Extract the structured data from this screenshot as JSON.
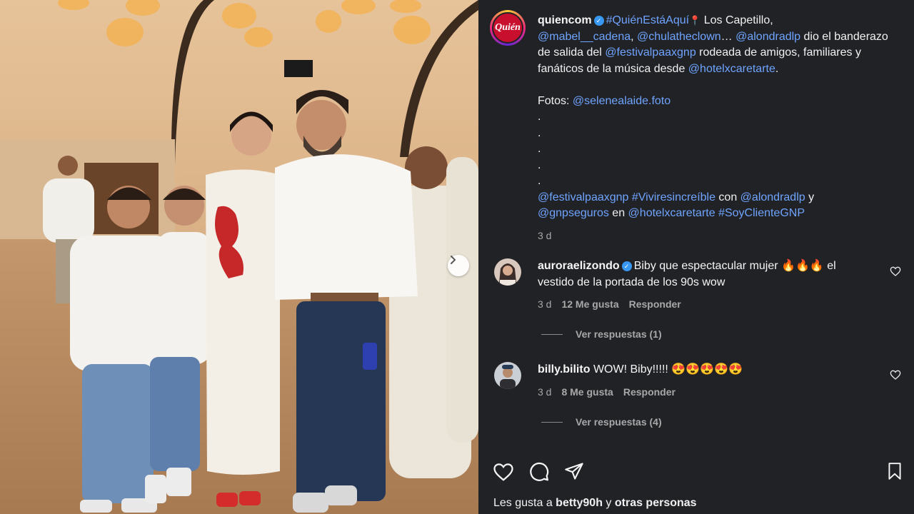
{
  "post": {
    "account": "quiencom",
    "avatar_text": "Quién",
    "caption": {
      "hashtag_here": "#QuiénEstáAquí",
      "t1": " Los Capetillo,",
      "m_mabel": "@mabel__cadena",
      "comma": ", ",
      "m_chula": "@chulatheclown",
      "ellipsis": "… ",
      "m_alondra": "@alondradlp",
      "t2": " dio el banderazo de salida del ",
      "m_festival": "@festivalpaaxgnp",
      "t3": " rodeada de amigos, familiares y fanáticos de la música desde ",
      "m_hotel": "@hotelxcaretarte",
      "t4": ".",
      "fotos_label": "Fotos: ",
      "m_selene": "@selenealaide.foto",
      "dot": ".",
      "m_festival2": "@festivalpaaxgnp",
      "sp": " ",
      "h_vivir": "#Viviresincreíble",
      "con": " con ",
      "m_alondra2": "@alondradlp",
      "y": " y",
      "m_gnp": "@gnpseguros",
      "en": " en ",
      "m_hotel2": "@hotelxcaretarte",
      "h_soy": "#SoyClienteGNP"
    },
    "time": "3 d"
  },
  "comments": [
    {
      "user": "auroraelizondo",
      "text": "Biby que espectacular mujer 🔥🔥🔥 el vestido de la portada de los 90s wow",
      "time": "3 d",
      "likes": "12 Me gusta",
      "reply": "Responder",
      "view_replies": "Ver respuestas (1)"
    },
    {
      "user": "billy.bilito",
      "text": "WOW! Biby!!!!! 😍😍😍😍😍",
      "time": "3 d",
      "likes": "8 Me gusta",
      "reply": "Responder",
      "view_replies": "Ver respuestas (4)"
    }
  ],
  "likes_bar": {
    "prefix": "Les gusta a ",
    "user": "betty90h",
    "middle": " y ",
    "rest": "otras personas"
  },
  "icons": {
    "like": "heart-icon",
    "comment": "comment-icon",
    "share": "send-icon",
    "save": "bookmark-icon",
    "next": "chevron-right-icon"
  },
  "colors": {
    "background": "#212226",
    "link": "#6fa4ff",
    "verified": "#3897f0"
  }
}
